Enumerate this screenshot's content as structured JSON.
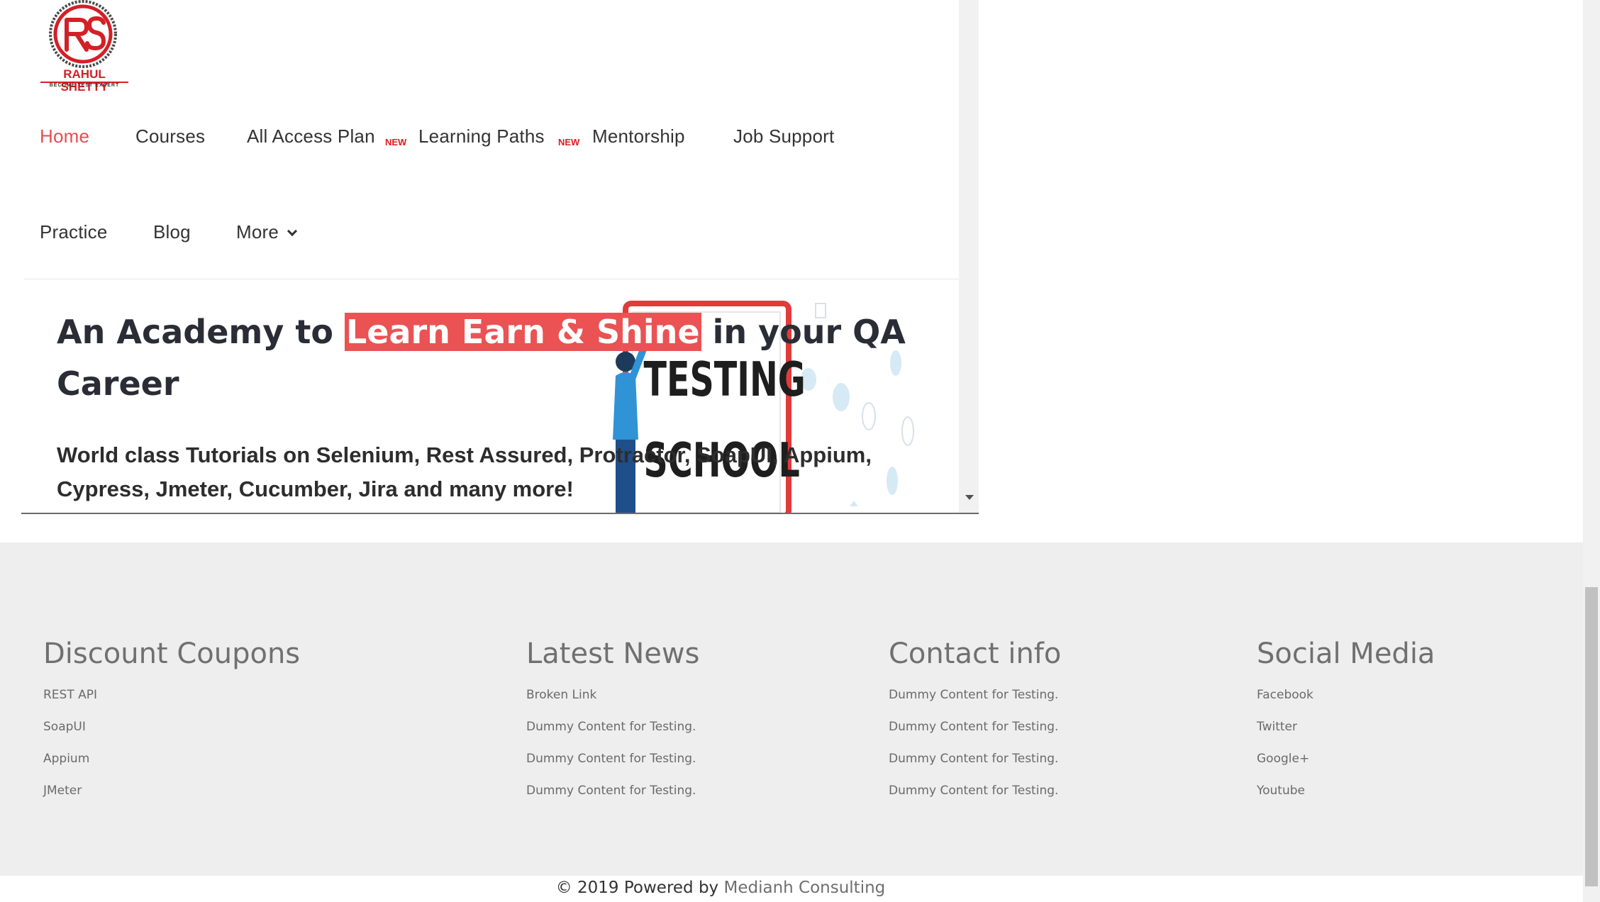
{
  "logo": {
    "name": "RAHUL SHETTY",
    "tagline": "BECOME TEST EXPERT",
    "monogram": "RS"
  },
  "nav": {
    "items": [
      {
        "label": "Home",
        "active": true
      },
      {
        "label": "Courses"
      },
      {
        "label": "All Access Plan",
        "badge": "NEW"
      },
      {
        "label": "Learning Paths",
        "badge": "NEW"
      },
      {
        "label": "Mentorship"
      },
      {
        "label": "Job Support"
      },
      {
        "label": "Practice"
      },
      {
        "label": "Blog"
      },
      {
        "label": "More",
        "icon": "chevron-down-icon"
      }
    ]
  },
  "hero": {
    "title_pre": "An Academy to ",
    "title_highlight": "Learn Earn & Shine",
    "title_post": "  in your QA Career",
    "subtitle": "World class Tutorials on Selenium, Rest Assured, Protractor, SoapUI, Appium, Cypress, Jmeter, Cucumber, Jira and many more!",
    "illustration_text_1": "TESTING",
    "illustration_text_2": "SCHOOL"
  },
  "footer": {
    "columns": [
      {
        "heading": "Discount Coupons",
        "links": [
          "REST API",
          "SoapUI",
          "Appium",
          "JMeter"
        ]
      },
      {
        "heading": "Latest News",
        "links": [
          "Broken Link",
          "Dummy Content for Testing.",
          "Dummy Content for Testing.",
          "Dummy Content for Testing."
        ]
      },
      {
        "heading": "Contact info",
        "links": [
          "Dummy Content for Testing.",
          "Dummy Content for Testing.",
          "Dummy Content for Testing.",
          "Dummy Content for Testing."
        ]
      },
      {
        "heading": "Social Media",
        "links": [
          "Facebook",
          "Twitter",
          "Google+",
          "Youtube"
        ]
      }
    ]
  },
  "copyright": {
    "text": "© 2019 Powered by ",
    "link": "Medianh Consulting"
  },
  "colors": {
    "accent": "#e74c4f",
    "highlight_bg": "#eb5253",
    "footer_bg": "#eeeeee",
    "badge": "#e01b22"
  }
}
